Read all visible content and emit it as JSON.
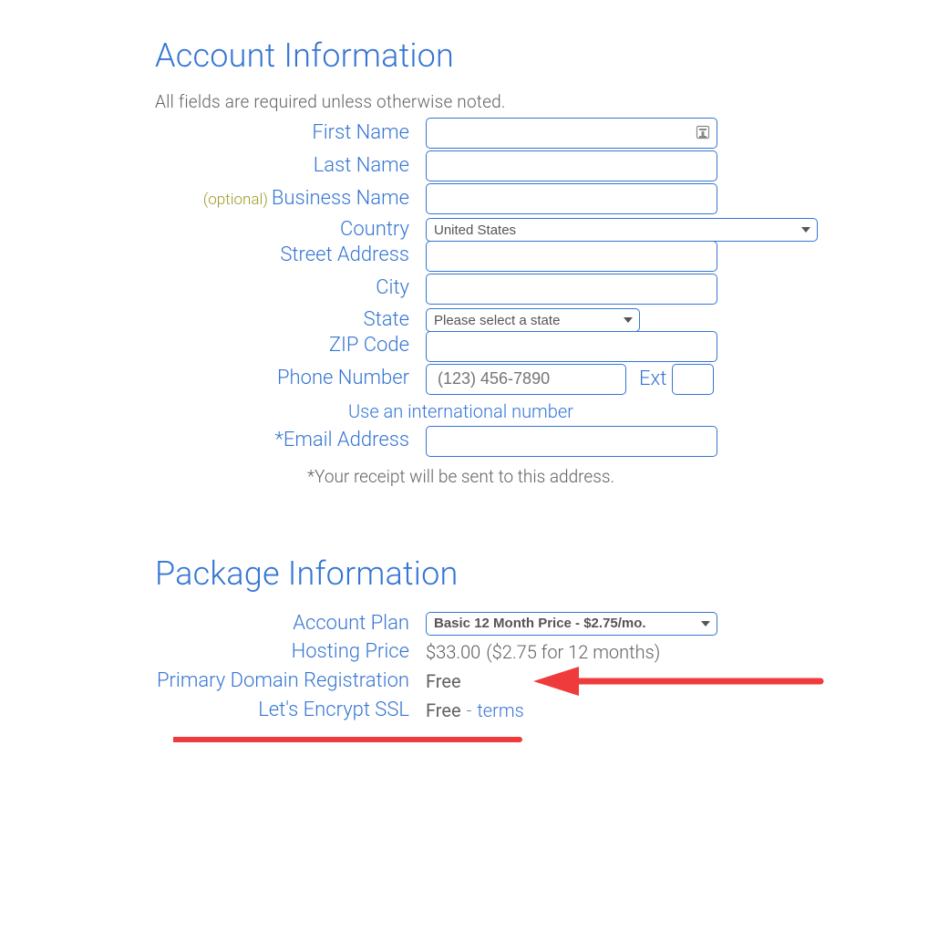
{
  "account": {
    "title": "Account Information",
    "required_note": "All fields are required unless otherwise noted.",
    "fields": {
      "first_name_label": "First Name",
      "last_name_label": "Last Name",
      "optional_tag": "(optional)",
      "business_name_label": "Business Name",
      "country_label": "Country",
      "country_value": "United States",
      "street_label": "Street Address",
      "city_label": "City",
      "state_label": "State",
      "state_value": "Please select a state",
      "zip_label": "ZIP Code",
      "phone_label": "Phone Number",
      "phone_placeholder": "(123) 456-7890",
      "ext_label": "Ext",
      "intl_link": "Use an international number",
      "email_label": "*Email Address",
      "email_note": "*Your receipt will be sent to this address."
    }
  },
  "package": {
    "title": "Package Information",
    "rows": {
      "plan_label": "Account Plan",
      "plan_value": "Basic 12 Month Price - $2.75/mo.",
      "price_label": "Hosting Price",
      "price_value": "$33.00",
      "price_detail": "($2.75 for 12 months)",
      "domain_label": "Primary Domain Registration",
      "domain_value": "Free",
      "ssl_label": "Let's Encrypt SSL",
      "ssl_value": "Free",
      "ssl_dash": "-",
      "ssl_terms": "terms"
    }
  }
}
